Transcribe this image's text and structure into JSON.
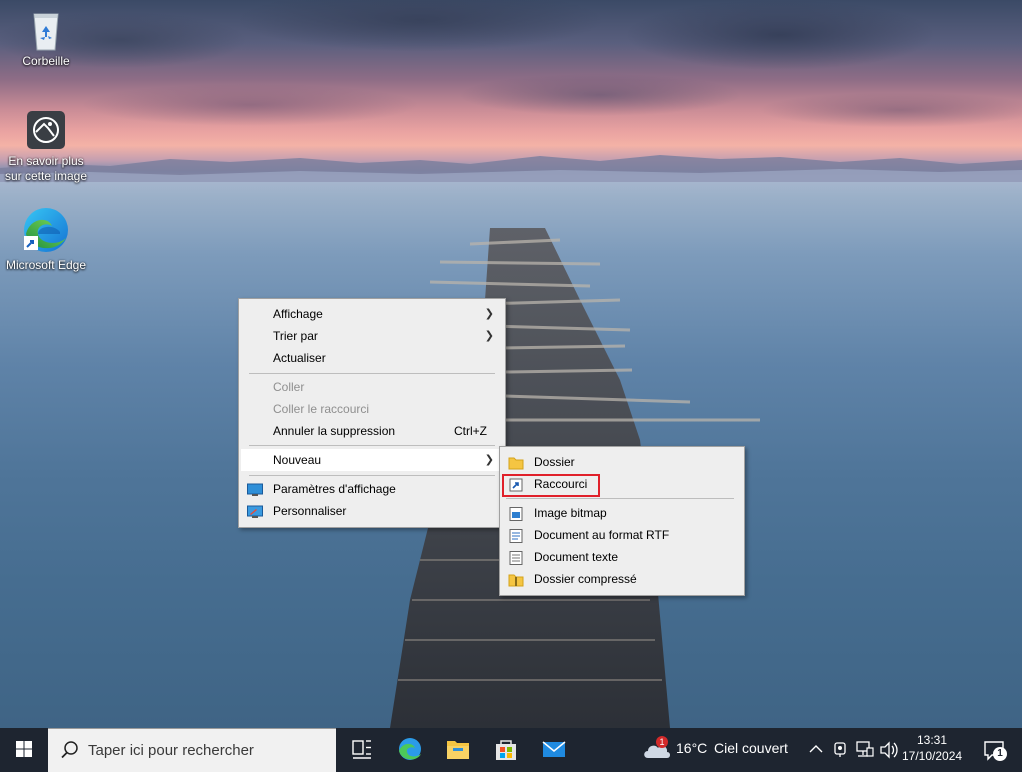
{
  "desktop": {
    "icons": [
      {
        "label": "Corbeille"
      },
      {
        "label": "En savoir plus sur cette image"
      },
      {
        "label": "Microsoft Edge"
      }
    ]
  },
  "context_menu": {
    "items": [
      {
        "label": "Affichage",
        "submenu": true
      },
      {
        "label": "Trier par",
        "submenu": true
      },
      {
        "label": "Actualiser"
      },
      {
        "label": "Coller",
        "disabled": true
      },
      {
        "label": "Coller le raccourci",
        "disabled": true
      },
      {
        "label": "Annuler la suppression",
        "shortcut": "Ctrl+Z"
      },
      {
        "label": "Nouveau",
        "submenu": true,
        "highlighted": true
      },
      {
        "label": "Paramètres d'affichage",
        "icon": "display-settings-icon"
      },
      {
        "label": "Personnaliser",
        "icon": "personalize-icon"
      }
    ]
  },
  "submenu_nouveau": {
    "items": [
      {
        "label": "Dossier",
        "icon": "folder-icon"
      },
      {
        "label": "Raccourci",
        "icon": "shortcut-icon",
        "outlined": true
      },
      {
        "label": "Image bitmap",
        "icon": "bitmap-icon"
      },
      {
        "label": "Document au format RTF",
        "icon": "rtf-document-icon"
      },
      {
        "label": "Document texte",
        "icon": "text-document-icon"
      },
      {
        "label": "Dossier compressé",
        "icon": "zip-folder-icon"
      }
    ],
    "highlight_color": "#e0202a"
  },
  "taskbar": {
    "search_placeholder": "Taper ici pour rechercher",
    "weather_temp": "16°C",
    "weather_desc": "Ciel couvert",
    "weather_badge": "1",
    "time": "13:31",
    "date": "17/10/2024",
    "notification_count": "1",
    "background": "#1e2530"
  }
}
